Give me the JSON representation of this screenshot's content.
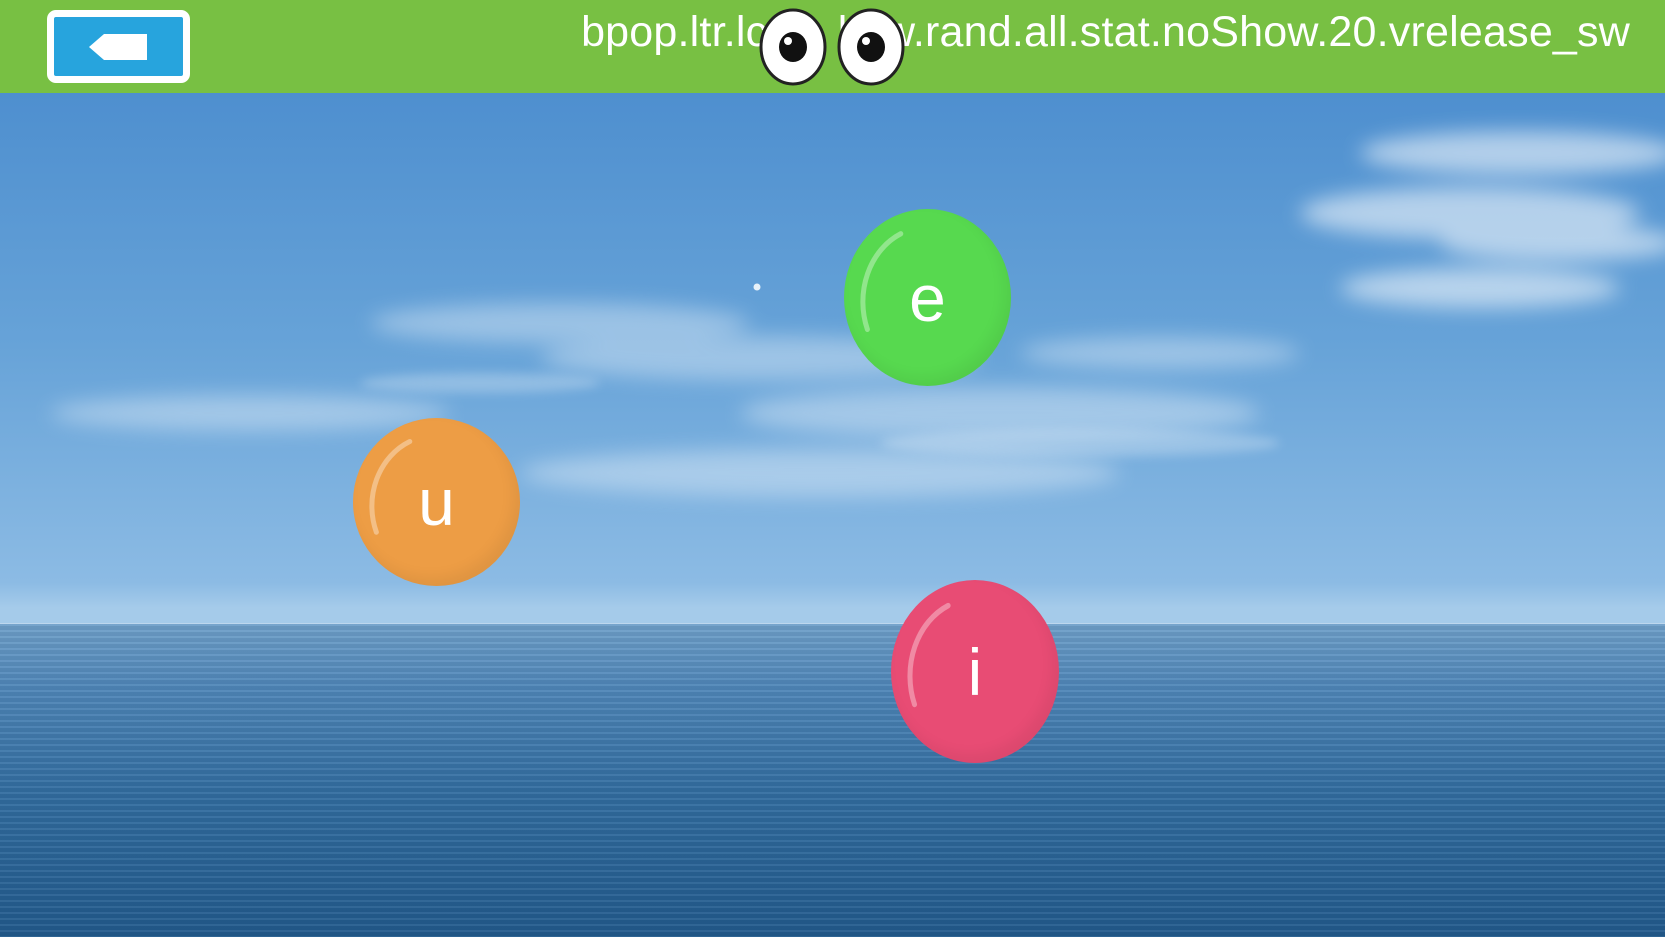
{
  "header": {
    "title": "bpop.ltr.lc:l... l...w.rand.all.stat.noShow.20.vrelease_sw",
    "back_button_icon": "back-arrow-icon",
    "background_color": "#78c043",
    "back_button_color": "#27a4dd",
    "mascot_icon": "eyes-icon"
  },
  "scene": {
    "background": "sky-over-sea-photo",
    "bubbles": [
      {
        "letter": "e",
        "color": "#57d94f"
      },
      {
        "letter": "u",
        "color": "#ed9d45"
      },
      {
        "letter": "i",
        "color": "#e84c74"
      }
    ]
  }
}
